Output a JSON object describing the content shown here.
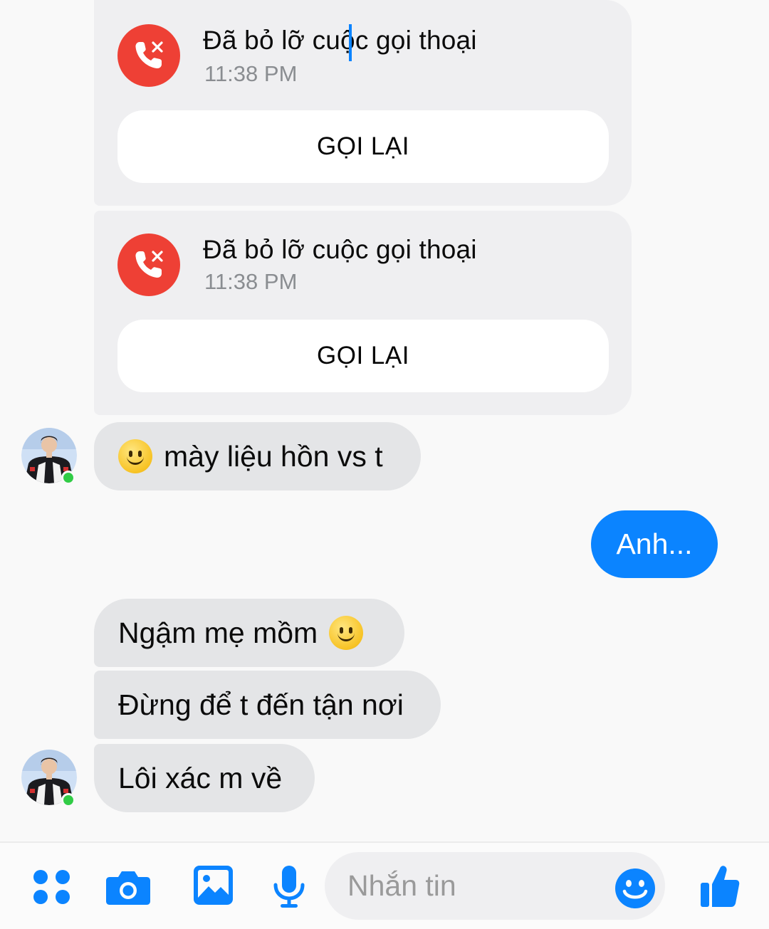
{
  "missed_calls": [
    {
      "title": "Đã bỏ lỡ cuộc gọi thoại",
      "time": "11:38 PM",
      "action_label": "GỌI LẠI"
    },
    {
      "title": "Đã bỏ lỡ cuộc gọi thoại",
      "time": "11:38 PM",
      "action_label": "GỌI LẠI"
    }
  ],
  "messages": [
    {
      "direction": "incoming",
      "text": "mày liệu hồn vs t",
      "emoji": "slightly-smiling-face"
    },
    {
      "direction": "outgoing",
      "text": "Anh..."
    },
    {
      "direction": "incoming",
      "text": "Ngậm mẹ mồm",
      "emoji": "slightly-smiling-face"
    },
    {
      "direction": "incoming",
      "text": "Đừng để t đến tận nơi"
    },
    {
      "direction": "incoming",
      "text": "Lôi xác m về"
    }
  ],
  "composer": {
    "placeholder": "Nhắn tin",
    "icons": [
      "apps-grid-icon",
      "camera-icon",
      "photo-icon",
      "microphone-icon",
      "emoji-icon",
      "thumbs-up-icon"
    ]
  },
  "colors": {
    "accent": "#0b84ff",
    "missed_call": "#ee4035",
    "incoming_bubble": "#e4e5e7",
    "online": "#31cc46"
  }
}
